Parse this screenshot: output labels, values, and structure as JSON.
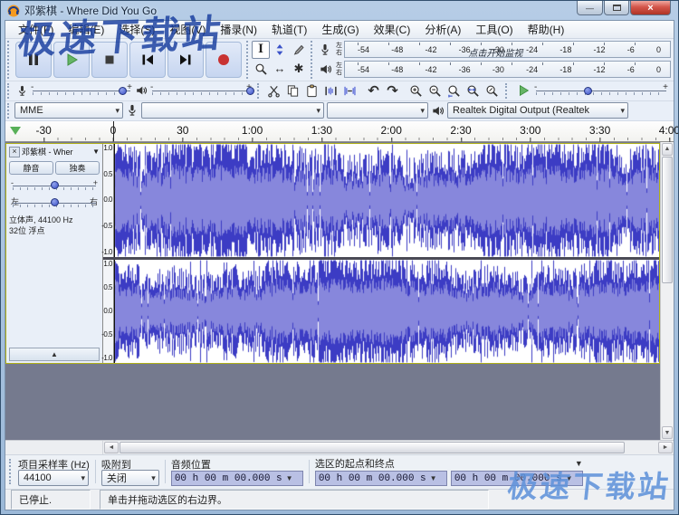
{
  "window": {
    "title": "邓紫棋 - Where Did You Go",
    "watermark_top": "极速下载站",
    "watermark_bottom": "极速下载站"
  },
  "menu": {
    "items": [
      "文件(F)",
      "编辑(E)",
      "选择(S)",
      "视图(V)",
      "播录(N)",
      "轨道(T)",
      "生成(G)",
      "效果(C)",
      "分析(A)",
      "工具(O)",
      "帮助(H)"
    ]
  },
  "meters": {
    "scale": [
      "-54",
      "-48",
      "-42",
      "-36",
      "-30",
      "-24",
      "-18",
      "-12",
      "-6",
      "0"
    ],
    "left_label": "左",
    "right_label": "右",
    "record_overlay": "点击开始监视"
  },
  "device": {
    "host": "MME",
    "input": "",
    "channels": "",
    "output": "Realtek Digital Output (Realtek"
  },
  "timeline": {
    "ticks": [
      "-30",
      "0",
      "30",
      "1:00",
      "1:30",
      "2:00",
      "2:30",
      "3:00",
      "3:30",
      "4:00"
    ]
  },
  "track": {
    "name": "邓紫棋 - Wher",
    "mute": "静音",
    "solo": "独奏",
    "pan_left": "左",
    "pan_right": "右",
    "info_line1": "立体声, 44100 Hz",
    "info_line2": "32位 浮点",
    "ruler": [
      "1.0",
      "0.5",
      "0.0",
      "-0.5",
      "-1.0"
    ]
  },
  "selection_bar": {
    "rate_label": "项目采样率  (Hz)",
    "rate_value": "44100",
    "snap_label": "吸附到",
    "snap_value": "关闭",
    "position_label": "音频位置",
    "position_value": "00 h 00 m 00.000 s",
    "range_label": "选区的起点和终点",
    "sel_start": "00 h 00 m 00.000 s",
    "sel_end": "00 h 00 m 00.000 s"
  },
  "status_bar": {
    "state": "已停止.",
    "hint": "单击并拖动选区的右边界。"
  },
  "icons": {
    "close_track": "×",
    "dropdown": "▼",
    "collapse": "▲",
    "up": "▲",
    "down": "▼",
    "left": "◄",
    "right": "►",
    "undo": "↶",
    "redo": "↷",
    "timeshift": "↔",
    "multitool": "✱",
    "ibeam": "I",
    "minus": "-",
    "plus": "+",
    "win_min": "—",
    "win_close": "×"
  },
  "colors": {
    "waveform": "#3c3cc4",
    "waveform_rms": "#8787dc",
    "record_red": "#c83232",
    "play_green": "#66b566"
  }
}
